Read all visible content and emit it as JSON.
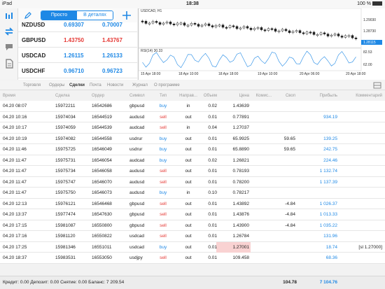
{
  "status": {
    "device": "iPad",
    "time": "18:38",
    "battery": "100 %"
  },
  "segment": {
    "simple": "Просто",
    "detailed": "В деталях"
  },
  "quotes": [
    {
      "symbol": "NZDUSD",
      "bid": "0.69307",
      "ask": "0.70007"
    },
    {
      "symbol": "GBPUSD",
      "bid": "1.43750",
      "ask": "1.43767"
    },
    {
      "symbol": "USDCAD",
      "bid": "1.26115",
      "ask": "1.26133"
    },
    {
      "symbol": "USDCHF",
      "bid": "0.96710",
      "ask": "0.96723"
    }
  ],
  "chart": {
    "title": "USDCAD, H1",
    "indicator": "RSI(14) 30.33",
    "price_labels": [
      "1.29030",
      "1.28730",
      "1.28115",
      "82.53",
      "62.00"
    ],
    "time_labels": [
      "15 Apr 18:00",
      "18 Apr 02:00",
      "18 Apr 10:00",
      "18 Apr 18:00",
      "19 Apr 02:00",
      "19 Apr 10:00",
      "19 Apr 18:00",
      "20 Apr 06:00",
      "20 Apr 18:00"
    ]
  },
  "tabs": [
    "Торговля",
    "Ордеры",
    "Сделки",
    "Почта",
    "Новости",
    "Журнал",
    "О программе"
  ],
  "columns": [
    "Время",
    "Сделка",
    "Ордер",
    "Символ",
    "Тип",
    "Направ...",
    "Объем",
    "Цена",
    "Комис...",
    "Своп",
    "Прибыль",
    "Комментарий"
  ],
  "deals": [
    {
      "time": "04.20 08:07",
      "deal": "15972211",
      "order": "16542686",
      "symbol": "gbpusd",
      "type": "buy",
      "dir": "in",
      "vol": "0.02",
      "price": "1.43639",
      "comm": "",
      "swap": "",
      "profit": "",
      "comment": ""
    },
    {
      "time": "04.20 10:16",
      "deal": "15974034",
      "order": "16544519",
      "symbol": "audusd",
      "type": "sell",
      "dir": "out",
      "vol": "0.01",
      "price": "0.77891",
      "comm": "",
      "swap": "",
      "profit": "934.19",
      "comment": ""
    },
    {
      "time": "04.20 10:17",
      "deal": "15974059",
      "order": "16544539",
      "symbol": "audcad",
      "type": "sell",
      "dir": "in",
      "vol": "0.04",
      "price": "1.27037",
      "comm": "",
      "swap": "",
      "profit": "",
      "comment": ""
    },
    {
      "time": "04.20 10:19",
      "deal": "15974082",
      "order": "16544558",
      "symbol": "usdrur",
      "type": "buy",
      "dir": "out",
      "vol": "0.01",
      "price": "65.9925",
      "comm": "",
      "swap": "59.65",
      "profit": "139.25",
      "comment": ""
    },
    {
      "time": "04.20 11:46",
      "deal": "15975725",
      "order": "16546049",
      "symbol": "usdrur",
      "type": "buy",
      "dir": "out",
      "vol": "0.01",
      "price": "65.8890",
      "comm": "",
      "swap": "59.65",
      "profit": "242.75",
      "comment": ""
    },
    {
      "time": "04.20 11:47",
      "deal": "15975731",
      "order": "16546054",
      "symbol": "audcad",
      "type": "buy",
      "dir": "out",
      "vol": "0.02",
      "price": "1.26821",
      "comm": "",
      "swap": "",
      "profit": "224.46",
      "comment": ""
    },
    {
      "time": "04.20 11:47",
      "deal": "15975734",
      "order": "16546058",
      "symbol": "audusd",
      "type": "sell",
      "dir": "out",
      "vol": "0.01",
      "price": "0.78193",
      "comm": "",
      "swap": "",
      "profit": "1 132.74",
      "comment": ""
    },
    {
      "time": "04.20 11:47",
      "deal": "15975747",
      "order": "16546070",
      "symbol": "audusd",
      "type": "sell",
      "dir": "out",
      "vol": "0.01",
      "price": "0.78200",
      "comm": "",
      "swap": "",
      "profit": "1 137.39",
      "comment": ""
    },
    {
      "time": "04.20 11:47",
      "deal": "15975750",
      "order": "16546073",
      "symbol": "audusd",
      "type": "buy",
      "dir": "in",
      "vol": "0.10",
      "price": "0.78217",
      "comm": "",
      "swap": "",
      "profit": "",
      "comment": ""
    },
    {
      "time": "04.20 12:13",
      "deal": "15976121",
      "order": "16546468",
      "symbol": "gbpusd",
      "type": "sell",
      "dir": "out",
      "vol": "0.01",
      "price": "1.43892",
      "comm": "",
      "swap": "-4.84",
      "profit": "1 026.37",
      "comment": ""
    },
    {
      "time": "04.20 13:37",
      "deal": "15977474",
      "order": "16547630",
      "symbol": "gbpusd",
      "type": "sell",
      "dir": "out",
      "vol": "0.01",
      "price": "1.43876",
      "comm": "",
      "swap": "-4.84",
      "profit": "1 013.33",
      "comment": ""
    },
    {
      "time": "04.20 17:15",
      "deal": "15981087",
      "order": "16550800",
      "symbol": "gbpusd",
      "type": "sell",
      "dir": "out",
      "vol": "0.01",
      "price": "1.43900",
      "comm": "",
      "swap": "-4.84",
      "profit": "1 035.22",
      "comment": ""
    },
    {
      "time": "04.20 17:16",
      "deal": "15981120",
      "order": "16550822",
      "symbol": "usdcad",
      "type": "sell",
      "dir": "out",
      "vol": "0.01",
      "price": "1.26784",
      "comm": "",
      "swap": "",
      "profit": "131.96",
      "comment": ""
    },
    {
      "time": "04.20 17:25",
      "deal": "15981346",
      "order": "16551011",
      "symbol": "usdcad",
      "type": "buy",
      "dir": "out",
      "vol": "0.01",
      "price": "1.27001",
      "comm": "",
      "swap": "",
      "profit": "18.74",
      "comment": "[sl 1.27000]"
    },
    {
      "time": "04.20 18:37",
      "deal": "15983531",
      "order": "16553050",
      "symbol": "usdjpy",
      "type": "sell",
      "dir": "out",
      "vol": "0.01",
      "price": "109.458",
      "comm": "",
      "swap": "",
      "profit": "68.36",
      "comment": ""
    }
  ],
  "footer": {
    "summary": "Кредит: 0.00 Депозит: 0.00 Снятие: 0.00 Баланс: 7 209.54",
    "swap_total": "104.78",
    "profit_total": "7 104.76"
  },
  "colors": {
    "buy": "#1e88e5",
    "sell": "#e53935",
    "accent": "#1e88e5"
  }
}
